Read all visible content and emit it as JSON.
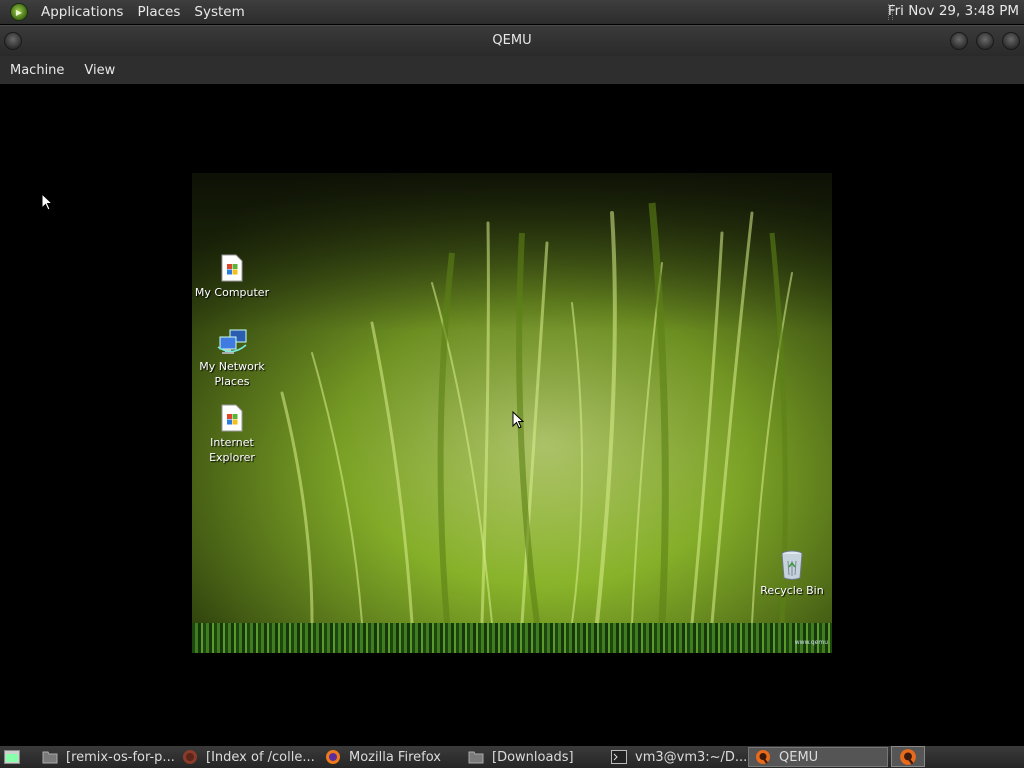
{
  "top_panel": {
    "menus": [
      "Applications",
      "Places",
      "System"
    ],
    "clock": "Fri Nov 29,  3:48 PM"
  },
  "window": {
    "title": "QEMU",
    "menus": [
      "Machine",
      "View"
    ]
  },
  "guest": {
    "desktop_icons": [
      {
        "label_lines": [
          "My Computer"
        ],
        "icon": "my-computer-icon"
      },
      {
        "label_lines": [
          "My Network",
          "Places"
        ],
        "icon": "network-places-icon"
      },
      {
        "label_lines": [
          "Internet",
          "Explorer"
        ],
        "icon": "internet-explorer-icon"
      },
      {
        "label_lines": [
          "Recycle Bin"
        ],
        "icon": "recycle-bin-icon"
      }
    ],
    "taskbar_corner_text": "www.qemu"
  },
  "taskbar": {
    "tasks": [
      {
        "label": "[remix-os-for-p...",
        "icon": "folder-icon"
      },
      {
        "label": "[Index of /colle...",
        "icon": "firefox-icon"
      },
      {
        "label": "Mozilla Firefox",
        "icon": "firefox-icon"
      },
      {
        "label": "[Downloads]",
        "icon": "folder-icon"
      },
      {
        "label": "vm3@vm3:~/D...",
        "icon": "terminal-icon"
      },
      {
        "label": "QEMU",
        "icon": "qemu-icon"
      }
    ]
  },
  "colors": {
    "panel_bg": "#2e2e2e",
    "wallpaper_green": "#8fbf2a",
    "active_task": "#555555"
  }
}
